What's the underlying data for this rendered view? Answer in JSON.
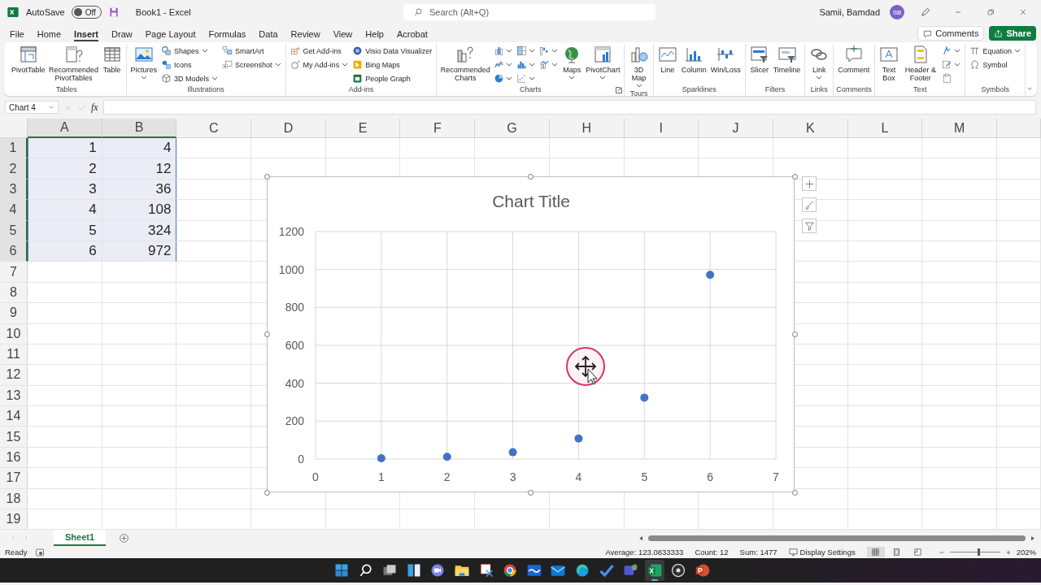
{
  "title_bar": {
    "autosave_label": "AutoSave",
    "autosave": {
      "on": false,
      "label": "Off"
    },
    "document_title": "Book1 - Excel",
    "search": {
      "placeholder": "Search (Alt+Q)"
    },
    "user_name": "Samii, Bamdad",
    "avatar_initials": "SB"
  },
  "menu_tabs": [
    {
      "label": "File",
      "selected": false
    },
    {
      "label": "Home",
      "selected": false
    },
    {
      "label": "Insert",
      "selected": true
    },
    {
      "label": "Draw",
      "selected": false
    },
    {
      "label": "Page Layout",
      "selected": false
    },
    {
      "label": "Formulas",
      "selected": false
    },
    {
      "label": "Data",
      "selected": false
    },
    {
      "label": "Review",
      "selected": false
    },
    {
      "label": "View",
      "selected": false
    },
    {
      "label": "Help",
      "selected": false
    },
    {
      "label": "Acrobat",
      "selected": false
    }
  ],
  "comments_button": "Comments",
  "share_button": "Share",
  "ribbon": {
    "groups": [
      {
        "label": "Tables",
        "dialog_launcher": false,
        "columns": [
          {
            "items": [
              {
                "kind": "large",
                "label": "PivotTable",
                "dropdown": false
              }
            ]
          },
          {
            "items": [
              {
                "kind": "large",
                "label": "Recommended PivotTables",
                "dropdown": false
              }
            ]
          },
          {
            "items": [
              {
                "kind": "large",
                "label": "Table",
                "dropdown": false
              }
            ]
          }
        ]
      },
      {
        "label": "Illustrations",
        "dialog_launcher": false,
        "columns": [
          {
            "items": [
              {
                "kind": "large",
                "label": "Pictures",
                "dropdown": true
              }
            ]
          },
          {
            "items": [
              {
                "kind": "small",
                "label": "Shapes",
                "dropdown": true
              },
              {
                "kind": "small",
                "label": "Icons",
                "dropdown": false
              },
              {
                "kind": "small",
                "label": "3D Models",
                "dropdown": true
              }
            ]
          },
          {
            "items": [
              {
                "kind": "small",
                "label": "SmartArt",
                "dropdown": false
              },
              {
                "kind": "small",
                "label": "Screenshot",
                "dropdown": true
              }
            ]
          }
        ]
      },
      {
        "label": "Add-ins",
        "dialog_launcher": false,
        "columns": [
          {
            "items": [
              {
                "kind": "small",
                "label": "Get Add-ins",
                "dropdown": false
              },
              {
                "kind": "small",
                "label": "My Add-ins",
                "dropdown": true
              }
            ]
          },
          {
            "items": [
              {
                "kind": "small",
                "label": "Visio Data Visualizer",
                "dropdown": false
              },
              {
                "kind": "small",
                "label": "Bing Maps",
                "dropdown": false
              },
              {
                "kind": "small",
                "label": "People Graph",
                "dropdown": false
              }
            ]
          }
        ]
      },
      {
        "label": "Charts",
        "dialog_launcher": true,
        "columns": [
          {
            "items": [
              {
                "kind": "large",
                "label": "Recommended Charts",
                "dropdown": false
              }
            ]
          },
          {
            "items": [
              {
                "kind": "icon",
                "dropdown": true
              },
              {
                "kind": "icon",
                "dropdown": true
              },
              {
                "kind": "icon",
                "dropdown": true
              }
            ]
          },
          {
            "items": [
              {
                "kind": "icon",
                "dropdown": true
              },
              {
                "kind": "icon",
                "dropdown": true
              },
              {
                "kind": "icon",
                "dropdown": true
              }
            ]
          },
          {
            "items": [
              {
                "kind": "icon",
                "dropdown": true
              },
              {
                "kind": "icon",
                "dropdown": true
              }
            ]
          },
          {
            "items": [
              {
                "kind": "large",
                "label": "Maps",
                "dropdown": true
              }
            ]
          },
          {
            "items": [
              {
                "kind": "large",
                "label": "PivotChart",
                "dropdown": true
              }
            ]
          }
        ]
      },
      {
        "label": "Tours",
        "dialog_launcher": false,
        "columns": [
          {
            "items": [
              {
                "kind": "large",
                "label": "3D Map",
                "dropdown": true
              }
            ]
          }
        ]
      },
      {
        "label": "Sparklines",
        "dialog_launcher": false,
        "columns": [
          {
            "items": [
              {
                "kind": "large",
                "label": "Line",
                "dropdown": false
              }
            ]
          },
          {
            "items": [
              {
                "kind": "large",
                "label": "Column",
                "dropdown": false
              }
            ]
          },
          {
            "items": [
              {
                "kind": "large",
                "label": "Win/Loss",
                "dropdown": false
              }
            ]
          }
        ]
      },
      {
        "label": "Filters",
        "dialog_launcher": false,
        "columns": [
          {
            "items": [
              {
                "kind": "large",
                "label": "Slicer",
                "dropdown": false
              }
            ]
          },
          {
            "items": [
              {
                "kind": "large",
                "label": "Timeline",
                "dropdown": false
              }
            ]
          }
        ]
      },
      {
        "label": "Links",
        "dialog_launcher": false,
        "columns": [
          {
            "items": [
              {
                "kind": "large",
                "label": "Link",
                "dropdown": true
              }
            ]
          }
        ]
      },
      {
        "label": "Comments",
        "dialog_launcher": false,
        "columns": [
          {
            "items": [
              {
                "kind": "large",
                "label": "Comment",
                "dropdown": false
              }
            ]
          }
        ]
      },
      {
        "label": "Text",
        "dialog_launcher": false,
        "columns": [
          {
            "items": [
              {
                "kind": "large",
                "label": "Text Box",
                "dropdown": false
              }
            ]
          },
          {
            "items": [
              {
                "kind": "large",
                "label": "Header & Footer",
                "dropdown": false
              }
            ]
          },
          {
            "items": [
              {
                "kind": "icon",
                "dropdown": true
              },
              {
                "kind": "icon",
                "dropdown": true
              },
              {
                "kind": "icon",
                "dropdown": false
              }
            ]
          }
        ]
      },
      {
        "label": "Symbols",
        "dialog_launcher": false,
        "columns": [
          {
            "items": [
              {
                "kind": "small",
                "label": "Equation",
                "dropdown": true
              },
              {
                "kind": "small",
                "label": "Symbol",
                "dropdown": false
              }
            ]
          }
        ]
      }
    ]
  },
  "formula_bar": {
    "name_box": "Chart 4",
    "function_label": "fx"
  },
  "sheet": {
    "columns": [
      {
        "label": "A",
        "highlighted": true
      },
      {
        "label": "B",
        "highlighted": true
      },
      {
        "label": "C",
        "highlighted": false
      },
      {
        "label": "D",
        "highlighted": false
      },
      {
        "label": "E",
        "highlighted": false
      },
      {
        "label": "F",
        "highlighted": false
      },
      {
        "label": "G",
        "highlighted": false
      },
      {
        "label": "H",
        "highlighted": false
      },
      {
        "label": "I",
        "highlighted": false
      },
      {
        "label": "J",
        "highlighted": false
      },
      {
        "label": "K",
        "highlighted": false
      },
      {
        "label": "L",
        "highlighted": false
      },
      {
        "label": "M",
        "highlighted": false
      }
    ],
    "rows": [
      {
        "number": "1",
        "highlighted": true,
        "cells": [
          "1",
          "4"
        ]
      },
      {
        "number": "2",
        "highlighted": true,
        "cells": [
          "2",
          "12"
        ]
      },
      {
        "number": "3",
        "highlighted": true,
        "cells": [
          "3",
          "36"
        ]
      },
      {
        "number": "4",
        "highlighted": true,
        "cells": [
          "4",
          "108"
        ]
      },
      {
        "number": "5",
        "highlighted": true,
        "cells": [
          "5",
          "324"
        ]
      },
      {
        "number": "6",
        "highlighted": true,
        "cells": [
          "6",
          "972"
        ]
      },
      {
        "number": "7",
        "highlighted": false
      },
      {
        "number": "8",
        "highlighted": false
      },
      {
        "number": "9",
        "highlighted": false
      },
      {
        "number": "10",
        "highlighted": false
      },
      {
        "number": "11",
        "highlighted": false
      },
      {
        "number": "12",
        "highlighted": false
      },
      {
        "number": "13",
        "highlighted": false
      },
      {
        "number": "14",
        "highlighted": false
      },
      {
        "number": "15",
        "highlighted": false
      },
      {
        "number": "16",
        "highlighted": false
      },
      {
        "number": "17",
        "highlighted": false
      },
      {
        "number": "18",
        "highlighted": false
      },
      {
        "number": "19",
        "highlighted": false
      }
    ]
  },
  "chart": {
    "chart_data": {
      "type": "scatter",
      "title": "Chart Title",
      "x": [
        1,
        2,
        3,
        4,
        5,
        6
      ],
      "series": [
        {
          "color": "#4472c4",
          "values": [
            4,
            12,
            36,
            108,
            324,
            972
          ]
        }
      ],
      "grid": true,
      "xlim": [
        0,
        7
      ],
      "ylim": [
        0,
        1200
      ],
      "xticks": [
        0,
        1,
        2,
        3,
        4,
        5,
        6,
        7
      ],
      "yticks": [
        0,
        200,
        400,
        600,
        800,
        1000,
        1200
      ]
    }
  },
  "sheet_tabs": [
    {
      "label": "Sheet1",
      "selected": true
    }
  ],
  "status_bar": {
    "mode": "Ready",
    "average": "Average: 123.0833333",
    "count": "Count: 12",
    "sum": "Sum: 1477",
    "display_settings": "Display Settings",
    "views": [
      {
        "selected": true
      },
      {
        "selected": false
      },
      {
        "selected": false
      }
    ],
    "zoom": {
      "level": 0.57,
      "reading": "202%"
    }
  },
  "taskbar": [
    {
      "active": false
    },
    {
      "active": false
    },
    {
      "active": false
    },
    {
      "active": false
    },
    {
      "active": false
    },
    {
      "active": false
    },
    {
      "active": false
    },
    {
      "active": false
    },
    {
      "active": false
    },
    {
      "active": false
    },
    {
      "active": false
    },
    {
      "active": false
    },
    {
      "active": false
    },
    {
      "active": true
    },
    {
      "active": false
    },
    {
      "active": false
    }
  ]
}
